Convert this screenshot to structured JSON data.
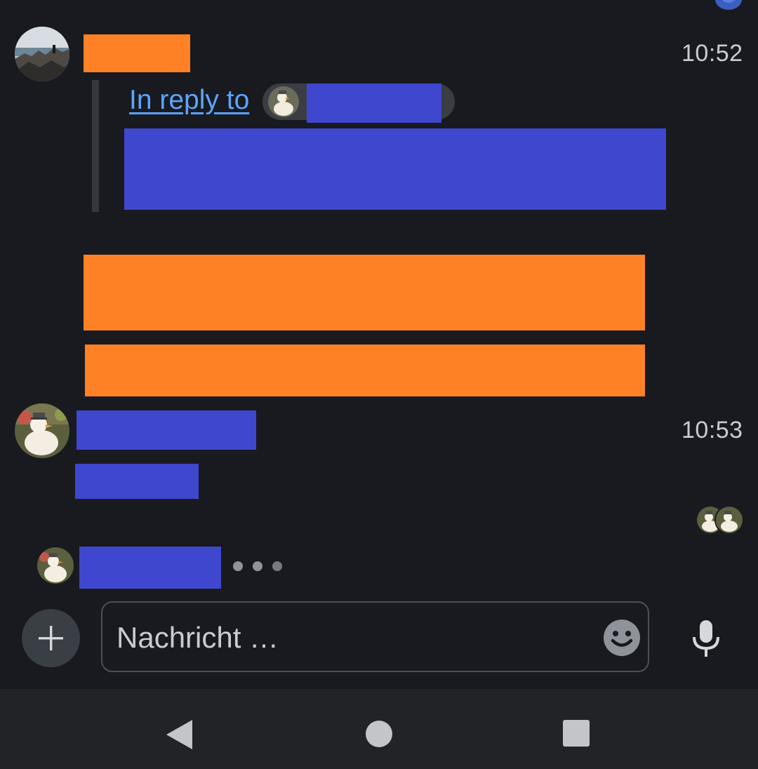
{
  "messages": [
    {
      "sender_avatar": "rocky-coast-avatar",
      "time": "10:52",
      "reply": {
        "link_text": "In reply to",
        "avatar": "duck-avatar"
      }
    },
    {
      "sender_avatar": "duck-avatar",
      "time": "10:53"
    }
  ],
  "read_receipts": [
    "duck-avatar",
    "duck-avatar"
  ],
  "typing": {
    "avatar": "duck-avatar",
    "indicator": "typing-dots"
  },
  "composer": {
    "placeholder": "Nachricht …",
    "add_icon": "plus-icon",
    "emoji_icon": "smiley-icon",
    "mic_icon": "microphone-icon"
  },
  "navbar": {
    "icons": [
      "back-icon",
      "home-icon",
      "recents-icon"
    ]
  },
  "colors": {
    "background": "#181a1f",
    "redaction_orange": "#ff8126",
    "redaction_blue": "#3f47cf",
    "link": "#5aa5ff",
    "navbar": "#212327"
  }
}
